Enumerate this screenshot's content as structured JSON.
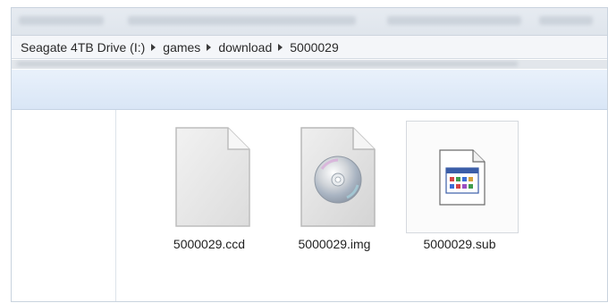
{
  "breadcrumb": {
    "items": [
      "Seagate 4TB Drive (I:)",
      "games",
      "download",
      "5000029"
    ]
  },
  "files": [
    {
      "name": "5000029.ccd",
      "icon": "blank-document-icon"
    },
    {
      "name": "5000029.img",
      "icon": "disc-image-icon"
    },
    {
      "name": "5000029.sub",
      "icon": "generic-window-file-icon",
      "selected": true
    }
  ],
  "colors": {
    "toolbar": "#dde8f6",
    "selection_border": "#d5d9de"
  }
}
